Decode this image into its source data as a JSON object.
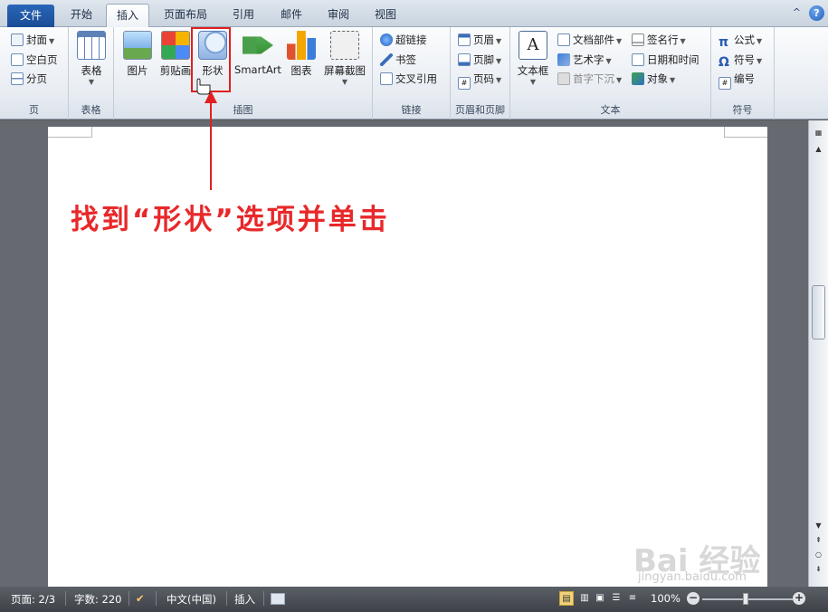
{
  "tabs": [
    {
      "label": "文件"
    },
    {
      "label": "开始"
    },
    {
      "label": "插入"
    },
    {
      "label": "页面布局"
    },
    {
      "label": "引用"
    },
    {
      "label": "邮件"
    },
    {
      "label": "审阅"
    },
    {
      "label": "视图"
    }
  ],
  "tab_right": {
    "minimize": "^",
    "help": "?"
  },
  "groups": {
    "pages": {
      "label": "页",
      "items": [
        "封面",
        "空白页",
        "分页"
      ]
    },
    "tables": {
      "label": "表格",
      "button": "表格"
    },
    "illustrations": {
      "label": "插图",
      "buttons": [
        "图片",
        "剪贴画",
        "形状",
        "SmartArt",
        "图表",
        "屏幕截图"
      ]
    },
    "links": {
      "label": "链接",
      "items": [
        "超链接",
        "书签",
        "交叉引用"
      ]
    },
    "header_footer": {
      "label": "页眉和页脚",
      "items": [
        "页眉",
        "页脚",
        "页码"
      ]
    },
    "text": {
      "label": "文本",
      "textbox": "文本框",
      "items_left": [
        "文档部件",
        "艺术字",
        "首字下沉"
      ],
      "items_right": [
        "签名行",
        "日期和时间",
        "对象"
      ]
    },
    "symbols": {
      "label": "符号",
      "items": [
        "公式",
        "符号",
        "编号"
      ]
    }
  },
  "annotation": {
    "text": "找到“形状”选项并单击",
    "color": "#e8282a"
  },
  "status": {
    "page": "页面: 2/3",
    "words": "字数: 220",
    "language": "中文(中国)",
    "mode": "插入",
    "zoom": "100%",
    "zoom_minus": "−",
    "zoom_plus": "+"
  },
  "watermark": {
    "main": "Bai 经验",
    "url": "jingyan.baidu.com"
  },
  "colors": {
    "accent": "#1a4d96",
    "highlight": "#e02020"
  }
}
